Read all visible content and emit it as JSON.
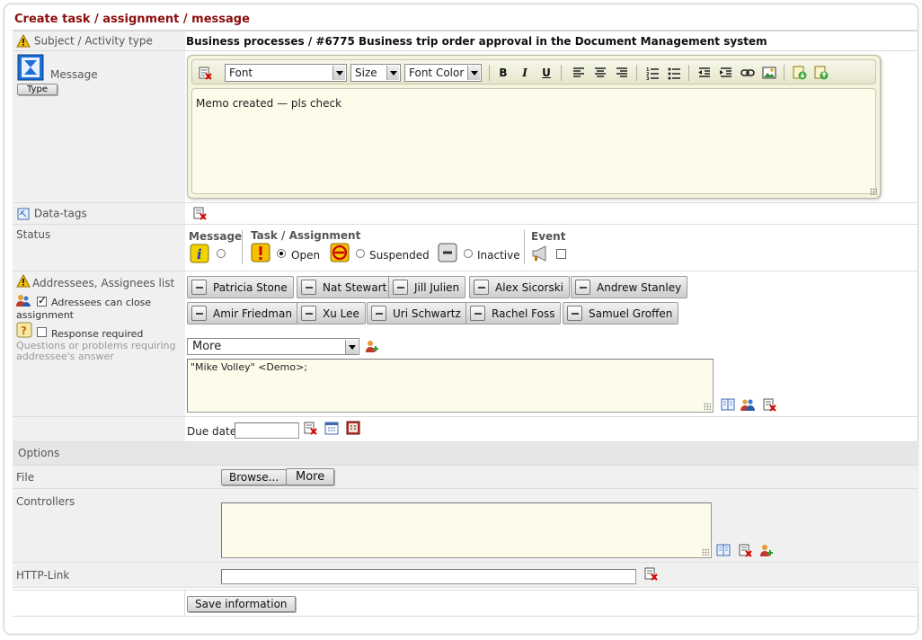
{
  "page": {
    "title": "Create task / assignment / message"
  },
  "subject": {
    "label": "Subject / Activity type",
    "value": "Business processes / #6775 Business trip order approval in the Document Management system"
  },
  "message": {
    "label": "Message",
    "type_button": "Type",
    "toolbar": {
      "font": "Font",
      "size": "Size",
      "font_color": "Font Color",
      "bold": "B",
      "italic": "I",
      "underline": "U"
    },
    "body": "Memo created — pls check"
  },
  "datatags": {
    "label": "Data-tags"
  },
  "status": {
    "label": "Status",
    "message_group": "Message",
    "task_group": "Task / Assignment",
    "open": "Open",
    "suspended": "Suspended",
    "inactive": "Inactive",
    "event_group": "Event"
  },
  "addressees": {
    "label": "Addressees, Assignees list",
    "can_close_label": "Adressees can close assignment",
    "response_label": "Response required",
    "hint": "Questions or problems requiring addressee's answer",
    "chips": [
      "Patricia Stone",
      "Nat Stewart",
      "Jill Julien",
      "Alex Sicorski",
      "Andrew Stanley",
      "Amir Friedman",
      "Xu Lee",
      "Uri Schwartz",
      "Rachel Foss",
      "Samuel Groffen"
    ],
    "more_select": "More",
    "recipients": "\"Mike Volley\" <Demo>;"
  },
  "due": {
    "label": "Due date",
    "value": ""
  },
  "options": {
    "header": "Options",
    "file_label": "File",
    "browse": "Browse...",
    "more": "More",
    "controllers_label": "Controllers",
    "controllers_value": "",
    "http_label": "HTTP-Link",
    "http_value": ""
  },
  "save": {
    "label": "Save information"
  },
  "colors": {
    "title": "#8b0d0d",
    "field_bg": "#fdfbea",
    "label_bg": "#f0f0f0"
  }
}
